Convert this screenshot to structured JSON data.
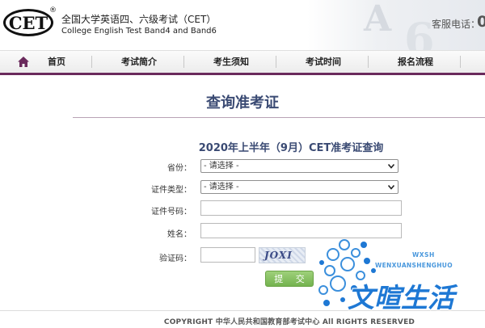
{
  "header": {
    "logo_text": "CET",
    "reg_mark": "®",
    "title_cn": "全国大学英语四、六级考试（CET）",
    "title_en": "College English Test Band4 and Band6",
    "hotline_label": "客服电话：",
    "hotline_number_visible": "0"
  },
  "nav": {
    "items": [
      {
        "label": "首页"
      },
      {
        "label": "考试简介"
      },
      {
        "label": "考生须知"
      },
      {
        "label": "考试时间"
      },
      {
        "label": "报名流程"
      }
    ]
  },
  "page": {
    "title": "查询准考证"
  },
  "form": {
    "title": "2020年上半年（9月）CET准考证查询",
    "province_label": "省份：",
    "province_value": "- 请选择 -",
    "id_type_label": "证件类型：",
    "id_type_value": "- 请选择 -",
    "id_number_label": "证件号码：",
    "name_label": "姓名：",
    "captcha_label": "验证码：",
    "captcha_text": "JOXI",
    "submit_label": "提 交"
  },
  "footer": {
    "copyright": "COPYRIGHT 中华人民共和国教育部考试中心 All RIGHTS RESERVED"
  },
  "watermark": {
    "small": "WXSH",
    "en": "WENXUANSHENGHUO",
    "cn": "文暄生活"
  },
  "colors": {
    "nav_underline": "#6a2a5c",
    "title": "#3a4a73",
    "submit": "#7fbf5a",
    "watermark": "#1e78d4"
  }
}
